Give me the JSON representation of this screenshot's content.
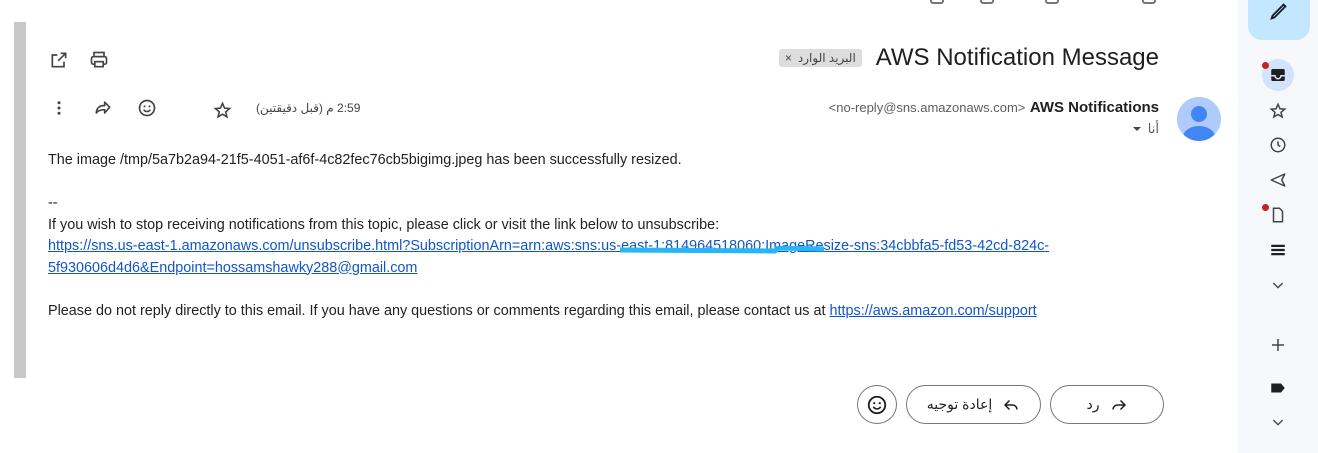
{
  "email": {
    "subject": "AWS Notification Message",
    "label_chip": {
      "label": "البريد الوارد",
      "remove_glyph": "×"
    },
    "sender": {
      "name": "AWS Notifications",
      "email": "<no-reply@sns.amazonaws.com>"
    },
    "recipient": "أنا",
    "timestamp": "2:59 م (قبل دقيقتين)",
    "body": {
      "line1": "The image /tmp/5a7b2a94-21f5-4051-af6f-4c82fec76cb5bigimg.jpeg has been successfully resized.",
      "signature_sep": "--",
      "unsubscribe_text": "If you wish to stop receiving notifications from this topic, please click or visit the link below to unsubscribe:",
      "unsubscribe_link_line1": "https://sns.us-east-1.amazonaws.com/unsubscribe.html?SubscriptionArn=arn:aws:sns:us-east-1:814964518060:ImageResize-sns:34cbbfa5-fd53-42cd-824c-",
      "unsubscribe_link_line2": "5f930606d4d6&Endpoint=hossamshawky288@gmail.com",
      "support_text": "Please do not reply directly to this email. If you have any questions or comments regarding this email, please contact us at ",
      "support_link": "https://aws.amazon.com/support"
    }
  },
  "actions": {
    "reply_label": "رد",
    "forward_label": "إعادة توجيه"
  },
  "icons": {
    "open_new_window": "open-in-new-window-icon",
    "print": "print-icon",
    "more": "more-vert-icon",
    "forward": "forward-icon",
    "emoji": "emoji-icon",
    "star": "star-icon"
  },
  "colors": {
    "link": "#1155cc",
    "compose_bg": "#c2e7ff",
    "rail_bg": "#f6f8fc",
    "active_rail": "#d3e3fd",
    "notification_dot": "#c5221f",
    "redaction": "#29b6f6"
  }
}
